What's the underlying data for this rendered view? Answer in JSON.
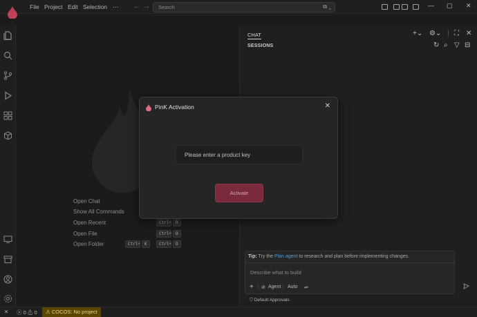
{
  "titlebar": {
    "menu": [
      "File",
      "Project",
      "Edit",
      "Selection",
      "⋯"
    ],
    "search_placeholder": "Search"
  },
  "chat": {
    "tab_label": "CHAT",
    "sessions_label": "SESSIONS",
    "tip_prefix": "Tip:",
    "tip_before": " Try the ",
    "tip_link": "Plan agent",
    "tip_after": " to research and plan before implementing changes.",
    "input_placeholder": "Describe what to build",
    "agent_label": "Agent",
    "auto_label": "Auto",
    "approvals_label": "Default Approvals"
  },
  "editor": {
    "commands": [
      {
        "label": "Open Chat"
      },
      {
        "label": "Show All Commands"
      },
      {
        "label": "Open Recent",
        "keys": [
          "Ctrl",
          "R"
        ]
      },
      {
        "label": "Open File",
        "keys": [
          "Ctrl",
          "O"
        ]
      },
      {
        "label": "Open Folder",
        "keys": [
          "Ctrl",
          "K",
          "Ctrl",
          "O"
        ]
      }
    ]
  },
  "modal": {
    "title": "PinK Activation",
    "key_placeholder": "Please enter a product key",
    "key_value": "",
    "activate_label": "Activate"
  },
  "statusbar": {
    "errors": "0",
    "warnings": "0",
    "cocos_label": "COCOS: No project"
  },
  "colors": {
    "accent_pink": "#c0405a",
    "activate_bg": "#7a2a3b",
    "link_blue": "#4a9edc",
    "cocos_bg": "#5b4600"
  }
}
